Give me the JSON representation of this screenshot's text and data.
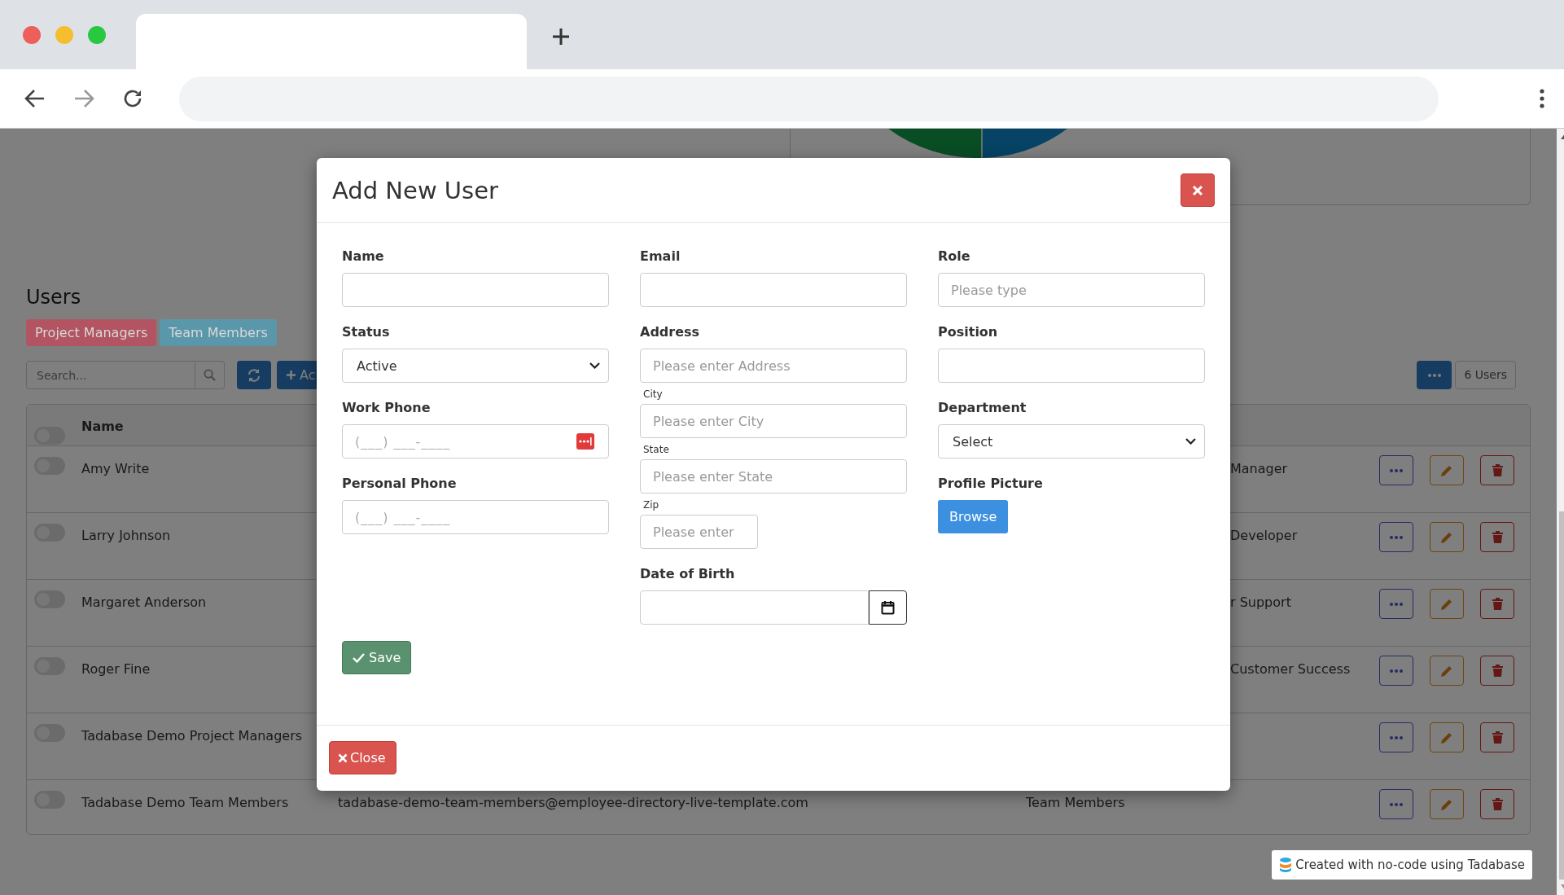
{
  "page": {
    "heading": "Users",
    "filter_tags": [
      {
        "label": "Project Managers",
        "color": "#b25462"
      },
      {
        "label": "Team Members",
        "color": "#5a97ab"
      }
    ],
    "search": {
      "placeholder": "Search..."
    },
    "add_button": {
      "label": "Ac"
    },
    "user_count": "6 Users",
    "table": {
      "select_all_on": false,
      "columns": [
        "Name"
      ],
      "rows": [
        {
          "name": "Amy Write",
          "on": false,
          "column_4": "Manager"
        },
        {
          "name": "Larry Johnson",
          "on": false,
          "column_4": "Developer"
        },
        {
          "name": "Margaret Anderson",
          "on": false,
          "column_4": "r Support"
        },
        {
          "name": "Roger Fine",
          "on": false,
          "column_4": "Customer Success"
        },
        {
          "name": "Tadabase Demo Project Managers",
          "on": false
        },
        {
          "name": "Tadabase Demo Team Members",
          "on": false,
          "email": "tadabase-demo-team-members@employee-directory-live-template.com",
          "column_3": "Team Members"
        }
      ]
    },
    "badge": "Created with no-code using Tadabase"
  },
  "modal": {
    "title": "Add New User",
    "columns": [
      [
        {
          "kind": "text",
          "label": "Name"
        },
        {
          "kind": "select",
          "label": "Status",
          "value": "Active"
        },
        {
          "kind": "phone",
          "label": "Work Phone",
          "placeholder": "(___) ___-____",
          "autofill_icon": true
        },
        {
          "kind": "phone",
          "label": "Personal Phone",
          "placeholder": "(___) ___-____",
          "autofill_icon": false
        }
      ],
      [
        {
          "kind": "text",
          "label": "Email"
        },
        {
          "kind": "text",
          "label": "Address",
          "placeholder": "Please enter Address"
        },
        {
          "kind": "subfield",
          "label": "City",
          "placeholder": "Please enter City"
        },
        {
          "kind": "subfield",
          "label": "State",
          "placeholder": "Please enter State"
        },
        {
          "kind": "zip",
          "label": "Zip",
          "placeholder": "Please enter"
        },
        {
          "kind": "date",
          "label": "Date of Birth"
        }
      ],
      [
        {
          "kind": "text",
          "label": "Role",
          "placeholder": "Please type"
        },
        {
          "kind": "text",
          "label": "Position"
        },
        {
          "kind": "select",
          "label": "Department",
          "value": "Select"
        },
        {
          "kind": "file",
          "label": "Profile Picture",
          "button": "Browse"
        }
      ]
    ],
    "save_button": "Save",
    "close_button": "Close"
  }
}
